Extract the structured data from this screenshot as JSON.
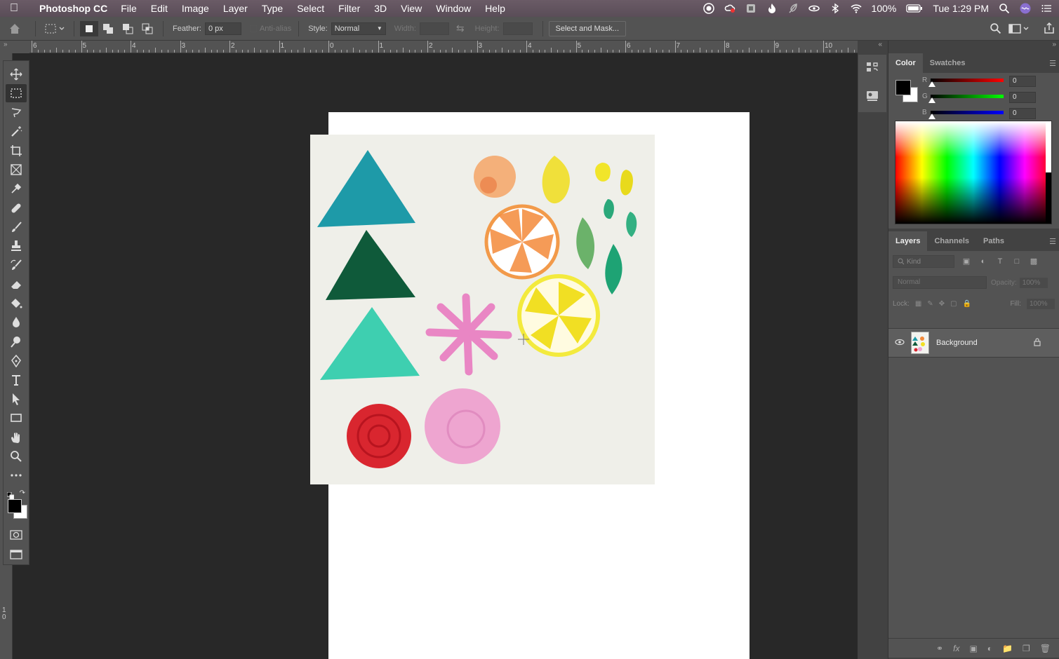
{
  "menubar": {
    "app_name": "Photoshop CC",
    "menus": [
      "File",
      "Edit",
      "Image",
      "Layer",
      "Type",
      "Select",
      "Filter",
      "3D",
      "View",
      "Window",
      "Help"
    ],
    "battery": "100%",
    "clock": "Tue 1:29 PM"
  },
  "options": {
    "feather_label": "Feather:",
    "feather_value": "0 px",
    "antialias_label": "Anti-alias",
    "style_label": "Style:",
    "style_value": "Normal",
    "width_label": "Width:",
    "height_label": "Height:",
    "select_mask_label": "Select and Mask..."
  },
  "ruler": {
    "top_labels": [
      "6",
      "5",
      "4",
      "3",
      "2",
      "1",
      "0",
      "1",
      "2",
      "3",
      "4",
      "5",
      "6",
      "7",
      "8",
      "9",
      "10"
    ],
    "left_label": "1 0"
  },
  "tools": [
    "move-tool",
    "rectangular-marquee-tool",
    "lasso-tool",
    "magic-wand-tool",
    "crop-tool",
    "frame-tool",
    "eyedropper-tool",
    "healing-brush-tool",
    "brush-tool",
    "clone-stamp-tool",
    "history-brush-tool",
    "eraser-tool",
    "paint-bucket-tool",
    "blur-tool",
    "dodge-tool",
    "pen-tool",
    "type-tool",
    "path-selection-tool",
    "rectangle-tool",
    "hand-tool",
    "zoom-tool",
    "more-tools"
  ],
  "color_panel": {
    "tabs": [
      "Color",
      "Swatches"
    ],
    "r_label": "R",
    "g_label": "G",
    "b_label": "B",
    "r_value": "0",
    "g_value": "0",
    "b_value": "0",
    "foreground": "#000000",
    "background": "#ffffff"
  },
  "layers_panel": {
    "tabs": [
      "Layers",
      "Channels",
      "Paths"
    ],
    "kind_placeholder": "Kind",
    "blend_mode": "Normal",
    "opacity_label": "Opacity:",
    "opacity_value": "100%",
    "lock_label": "Lock:",
    "fill_label": "Fill:",
    "fill_value": "100%",
    "layers": [
      {
        "name": "Background",
        "visible": true,
        "locked": true
      }
    ]
  },
  "document": {
    "canvas_color": "#ffffff",
    "artwork_color": "#efefe9"
  }
}
